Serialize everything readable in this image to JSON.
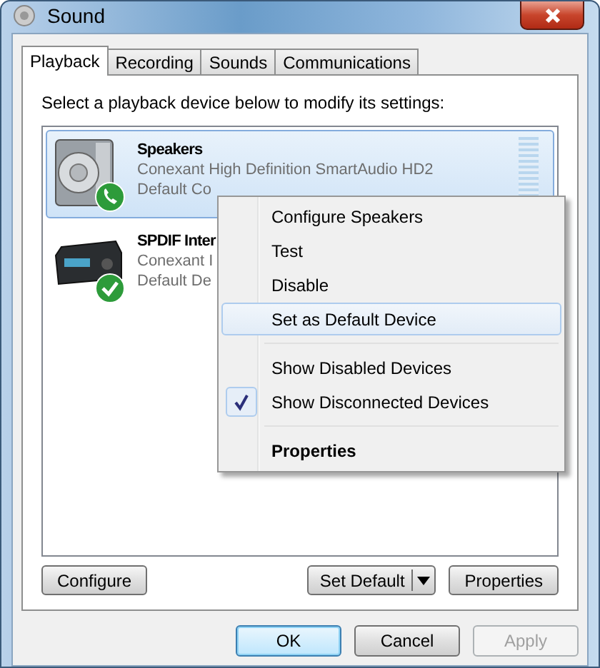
{
  "window": {
    "title": "Sound"
  },
  "tabs": [
    {
      "label": "Playback",
      "selected": true
    },
    {
      "label": "Recording",
      "selected": false
    },
    {
      "label": "Sounds",
      "selected": false
    },
    {
      "label": "Communications",
      "selected": false
    }
  ],
  "instruction": "Select a playback device below to modify its settings:",
  "devices": [
    {
      "kind": "speaker",
      "default_device": false,
      "default_communication": true,
      "selected": true,
      "name": "Speakers",
      "lines": [
        "Conexant High Definition SmartAudio HD2",
        "Default Co"
      ],
      "meter": true
    },
    {
      "kind": "receiver",
      "default_device": true,
      "default_communication": false,
      "selected": false,
      "name": "SPDIF Inter",
      "lines": [
        "Conexant I",
        "Default De"
      ]
    }
  ],
  "context_menu": {
    "groups": [
      [
        {
          "label": "Configure Speakers",
          "selected": false,
          "checked": false,
          "default": false
        },
        {
          "label": "Test",
          "selected": false,
          "checked": false,
          "default": false
        },
        {
          "label": "Disable",
          "selected": false,
          "checked": false,
          "default": false
        },
        {
          "label": "Set as Default Device",
          "selected": true,
          "checked": false,
          "default": false
        }
      ],
      [
        {
          "label": "Show Disabled Devices",
          "selected": false,
          "checked": false,
          "default": false
        },
        {
          "label": "Show Disconnected Devices",
          "selected": false,
          "checked": true,
          "default": false
        }
      ],
      [
        {
          "label": "Properties",
          "selected": false,
          "checked": false,
          "default": true
        }
      ]
    ]
  },
  "panel_buttons": [
    {
      "label": "Configure",
      "kind": "plain"
    },
    {
      "label": "Set Default",
      "kind": "split"
    },
    {
      "label": "Properties",
      "kind": "plain"
    }
  ],
  "dialog_buttons": [
    {
      "label": "OK",
      "default": true,
      "disabled": false
    },
    {
      "label": "Cancel",
      "default": false,
      "disabled": false
    },
    {
      "label": "Apply",
      "default": false,
      "disabled": true
    }
  ]
}
